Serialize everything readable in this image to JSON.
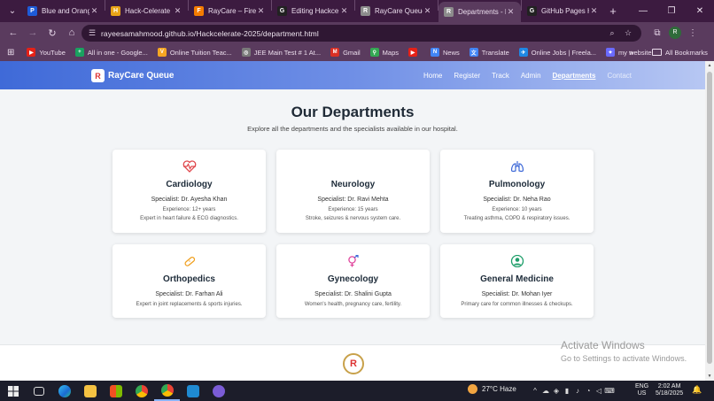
{
  "browser": {
    "tabs": [
      {
        "title": "Blue and Orange",
        "color": "#1e5bd8",
        "glyph": "P",
        "active": false
      },
      {
        "title": "Hack-Celerate P",
        "color": "#e8a317",
        "glyph": "H",
        "active": false
      },
      {
        "title": "RayCare – Fireb",
        "color": "#f57c00",
        "glyph": "F",
        "active": false
      },
      {
        "title": "Editing Hackce",
        "color": "#222222",
        "glyph": "G",
        "active": false
      },
      {
        "title": "RayCare Queue",
        "color": "#8c8c8c",
        "glyph": "R",
        "active": false
      },
      {
        "title": "Departments - R",
        "color": "#8c8c8c",
        "glyph": "R",
        "active": true
      },
      {
        "title": "GitHub Pages H",
        "color": "#222222",
        "glyph": "G",
        "active": false
      }
    ],
    "url": "rayeesamahmood.github.io/Hackcelerate-2025/department.html",
    "profile_initial": "R",
    "bookmarks": [
      {
        "label": "YouTube",
        "color": "#e62117",
        "glyph": "▶"
      },
      {
        "label": "All in one - Google...",
        "color": "#1aa260",
        "glyph": "+"
      },
      {
        "label": "Online Tuition Teac...",
        "color": "#f5a623",
        "glyph": "V"
      },
      {
        "label": "JEE Main Test # 1 At...",
        "color": "#7a7a7a",
        "glyph": "◎"
      },
      {
        "label": "Gmail",
        "color": "#d93025",
        "glyph": "M"
      },
      {
        "label": "Maps",
        "color": "#34a853",
        "glyph": "⚲"
      },
      {
        "label": "",
        "color": "#e62117",
        "glyph": "▶"
      },
      {
        "label": "News",
        "color": "#4285f4",
        "glyph": "N"
      },
      {
        "label": "Translate",
        "color": "#4285f4",
        "glyph": "文"
      },
      {
        "label": "Online Jobs | Freela...",
        "color": "#1e88e5",
        "glyph": "✈"
      },
      {
        "label": "my website",
        "color": "#6a6aff",
        "glyph": "✦"
      }
    ],
    "all_bookmarks_label": "All Bookmarks"
  },
  "site": {
    "brand": "RayCare Queue",
    "brand_logo_letter": "R",
    "nav": [
      {
        "label": "Home",
        "active": false
      },
      {
        "label": "Register",
        "active": false
      },
      {
        "label": "Track",
        "active": false
      },
      {
        "label": "Admin",
        "active": false
      },
      {
        "label": "Departments",
        "active": true
      },
      {
        "label": "Contact",
        "active": false
      }
    ],
    "title": "Our Departments",
    "subtitle": "Explore all the departments and the specialists available in our hospital.",
    "departments": [
      {
        "name": "Cardiology",
        "icon": "heart-pulse-icon",
        "icon_color": "#e0474c",
        "specialist": "Specialist: Dr. Ayesha Khan",
        "experience": "Experience: 12+ years",
        "description": "Expert in heart failure & ECG diagnostics."
      },
      {
        "name": "Neurology",
        "icon": "brain-icon",
        "icon_color": "#ffffff",
        "specialist": "Specialist: Dr. Ravi Mehta",
        "experience": "Experience: 15 years",
        "description": "Stroke, seizures & nervous system care."
      },
      {
        "name": "Pulmonology",
        "icon": "lungs-icon",
        "icon_color": "#3f6ad8",
        "specialist": "Specialist: Dr. Neha Rao",
        "experience": "Experience: 10 years",
        "description": "Treating asthma, COPD & respiratory issues."
      },
      {
        "name": "Orthopedics",
        "icon": "bandage-icon",
        "icon_color": "#f0a020",
        "specialist": "Specialist: Dr. Farhan Ali",
        "experience": "",
        "description": "Expert in joint replacements & sports injuries."
      },
      {
        "name": "Gynecology",
        "icon": "venus-icon",
        "icon_color": "#e0479e",
        "specialist": "Specialist: Dr. Shalini Gupta",
        "experience": "",
        "description": "Women's health, pregnancy care, fertility."
      },
      {
        "name": "General Medicine",
        "icon": "user-doctor-icon",
        "icon_color": "#1e9e6a",
        "specialist": "Specialist: Dr. Mohan Iyer",
        "experience": "",
        "description": "Primary care for common illnesses & checkups."
      }
    ],
    "footer_logo_letter": "R"
  },
  "watermark": {
    "line1": "Activate Windows",
    "line2": "Go to Settings to activate Windows."
  },
  "taskbar": {
    "weather": "27°C  Haze",
    "lang_line1": "ENG",
    "lang_line2": "US",
    "time": "2:02 AM",
    "date": "5/18/2025"
  }
}
